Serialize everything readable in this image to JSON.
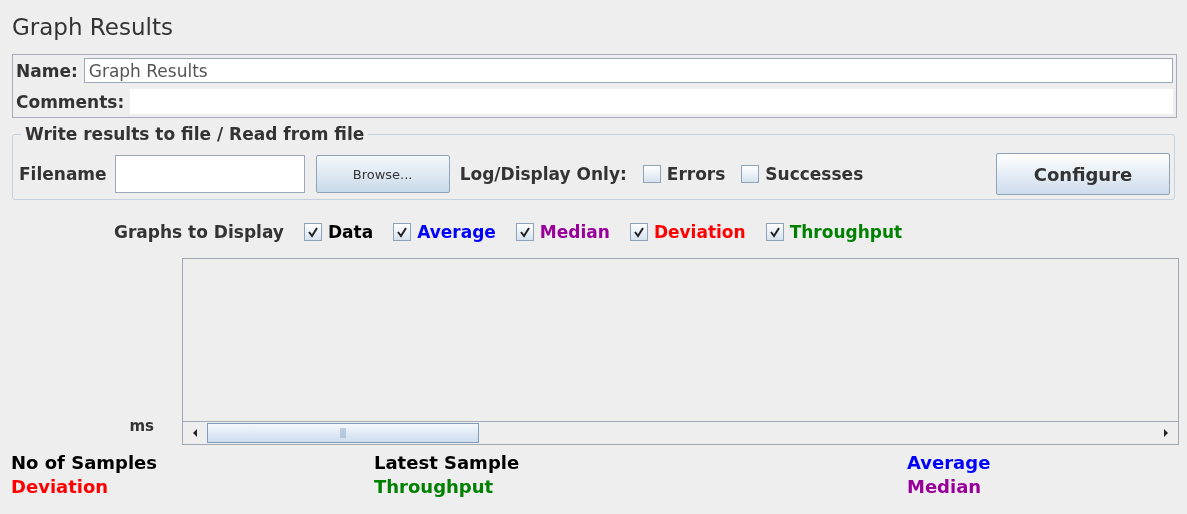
{
  "title": "Graph Results",
  "name": {
    "label": "Name:",
    "value": "Graph Results"
  },
  "comments": {
    "label": "Comments:"
  },
  "file_group": {
    "legend": "Write results to file / Read from file",
    "filename_label": "Filename",
    "browse_button": "Browse...",
    "log_label": "Log/Display Only:",
    "options": [
      {
        "label": "Errors",
        "checked": false
      },
      {
        "label": "Successes",
        "checked": false
      }
    ],
    "configure_button": "Configure"
  },
  "graphs": {
    "label": "Graphs to Display",
    "items": [
      {
        "label": "Data",
        "checked": true,
        "color": "#000000"
      },
      {
        "label": "Average",
        "checked": true,
        "color": "#0000ff"
      },
      {
        "label": "Median",
        "checked": true,
        "color": "#990099"
      },
      {
        "label": "Deviation",
        "checked": true,
        "color": "#ff0000"
      },
      {
        "label": "Throughput",
        "checked": true,
        "color": "#008000"
      }
    ]
  },
  "chart": {
    "y_unit": "ms"
  },
  "legend": [
    {
      "label": "No of Samples",
      "color": "#000000"
    },
    {
      "label": "Latest Sample",
      "color": "#000000"
    },
    {
      "label": "Average",
      "color": "#0000ff"
    },
    {
      "label": "Deviation",
      "color": "#ff0000"
    },
    {
      "label": "Throughput",
      "color": "#008000"
    },
    {
      "label": "Median",
      "color": "#990099"
    }
  ]
}
